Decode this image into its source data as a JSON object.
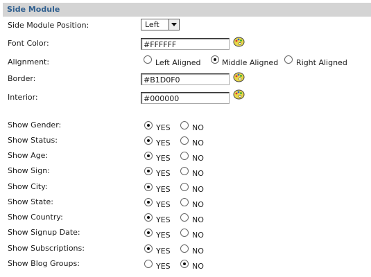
{
  "section_title": "Side Module",
  "position": {
    "label": "Side Module Position:",
    "value": "Left"
  },
  "font_color": {
    "label": "Font Color:",
    "value": "#FFFFFF",
    "icon": "color-palette-icon"
  },
  "alignment": {
    "label": "Alignment:",
    "options": [
      "Left Aligned",
      "Middle Aligned",
      "Right Aligned"
    ],
    "selected": "Middle Aligned"
  },
  "border": {
    "label": "Border:",
    "value": "#B1D0F0",
    "icon": "color-palette-icon"
  },
  "interior": {
    "label": "Interior:",
    "value": "#000000",
    "icon": "color-palette-icon"
  },
  "yes_label": "YES",
  "no_label": "NO",
  "toggles": [
    {
      "label": "Show Gender:",
      "value": "YES"
    },
    {
      "label": "Show Status:",
      "value": "YES"
    },
    {
      "label": "Show Age:",
      "value": "YES"
    },
    {
      "label": "Show Sign:",
      "value": "YES"
    },
    {
      "label": "Show City:",
      "value": "YES"
    },
    {
      "label": "Show State:",
      "value": "YES"
    },
    {
      "label": "Show Country:",
      "value": "YES"
    },
    {
      "label": "Show Signup Date:",
      "value": "YES"
    },
    {
      "label": "Show Subscriptions:",
      "value": "YES"
    },
    {
      "label": "Show Blog Groups:",
      "value": "NO"
    }
  ]
}
